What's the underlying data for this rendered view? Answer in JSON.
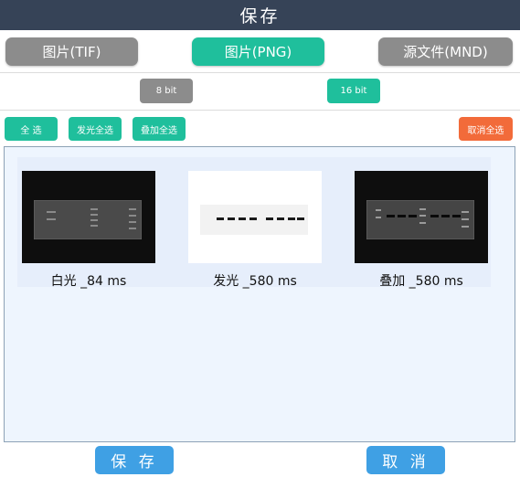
{
  "title": "保存",
  "format_tabs": [
    {
      "label": "图片(TIF)",
      "selected": false
    },
    {
      "label": "图片(PNG)",
      "selected": true
    },
    {
      "label": "源文件(MND)",
      "selected": false
    }
  ],
  "bit_options": [
    {
      "label": "8 bit",
      "selected": false
    },
    {
      "label": "16 bit",
      "selected": true
    }
  ],
  "select_buttons": {
    "select_all": "全 选",
    "select_chemi": "发光全选",
    "select_overlay": "叠加全选",
    "deselect_all": "取消全选"
  },
  "images": [
    {
      "caption": "白光 _84 ms",
      "style": "dark"
    },
    {
      "caption": "发光 _580 ms",
      "style": "light"
    },
    {
      "caption": "叠加 _580 ms",
      "style": "dark"
    }
  ],
  "actions": {
    "save": "保 存",
    "cancel": "取 消"
  },
  "colors": {
    "titlebar": "#364357",
    "teal": "#1fbf9c",
    "gray": "#8c8c8c",
    "orange": "#f26b3a",
    "blue": "#3fa0e4"
  }
}
